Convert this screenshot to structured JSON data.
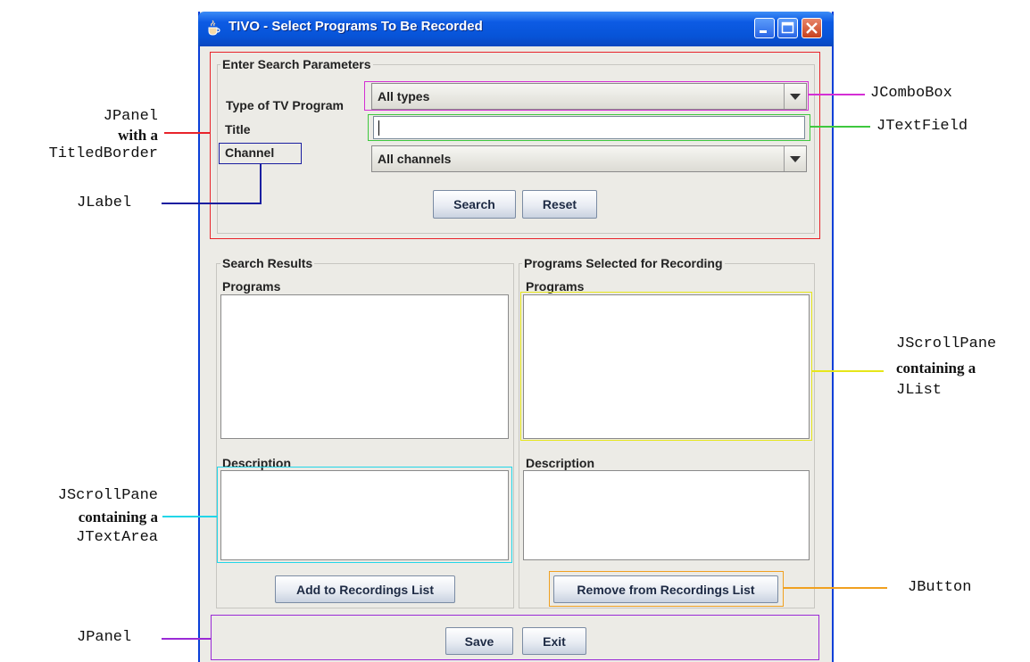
{
  "window": {
    "title": "TIVO - Select Programs To Be Recorded"
  },
  "search_panel": {
    "legend": "Enter Search Parameters",
    "type_label": "Type of TV Program",
    "type_value": "All types",
    "title_label": "Title",
    "title_value": "",
    "channel_label": "Channel",
    "channel_value": "All channels",
    "search_button": "Search",
    "reset_button": "Reset"
  },
  "results_panel": {
    "legend": "Search Results",
    "programs_label": "Programs",
    "description_label": "Description",
    "add_button": "Add to Recordings List"
  },
  "selected_panel": {
    "legend": "Programs Selected for Recording",
    "programs_label": "Programs",
    "description_label": "Description",
    "remove_button": "Remove from Recordings List"
  },
  "bottom_panel": {
    "save_button": "Save",
    "exit_button": "Exit"
  },
  "annotations": {
    "jpanel_titled": [
      "JPanel",
      "with a",
      "TitledBorder"
    ],
    "jlabel": "JLabel",
    "jcombobox": "JComboBox",
    "jtextfield": "JTextField",
    "jscrollpane_list": [
      "JScrollPane",
      "containing a",
      "JList"
    ],
    "jscrollpane_textarea": [
      "JScrollPane",
      "containing a",
      "JTextArea"
    ],
    "jbutton": "JButton",
    "jpanel": "JPanel"
  },
  "colors": {
    "titled_panel": "#e8232a",
    "jlabel": "#1a1ea0",
    "jcombobox": "#d42ed4",
    "jtextfield": "#3ec83e",
    "jlist": "#e6e61a",
    "jtextarea": "#22d6e8",
    "jbutton": "#f0a020",
    "jpanel": "#9a2ad6"
  },
  "icons": [
    "java-cup-icon",
    "minimize-icon",
    "maximize-icon",
    "close-icon"
  ]
}
